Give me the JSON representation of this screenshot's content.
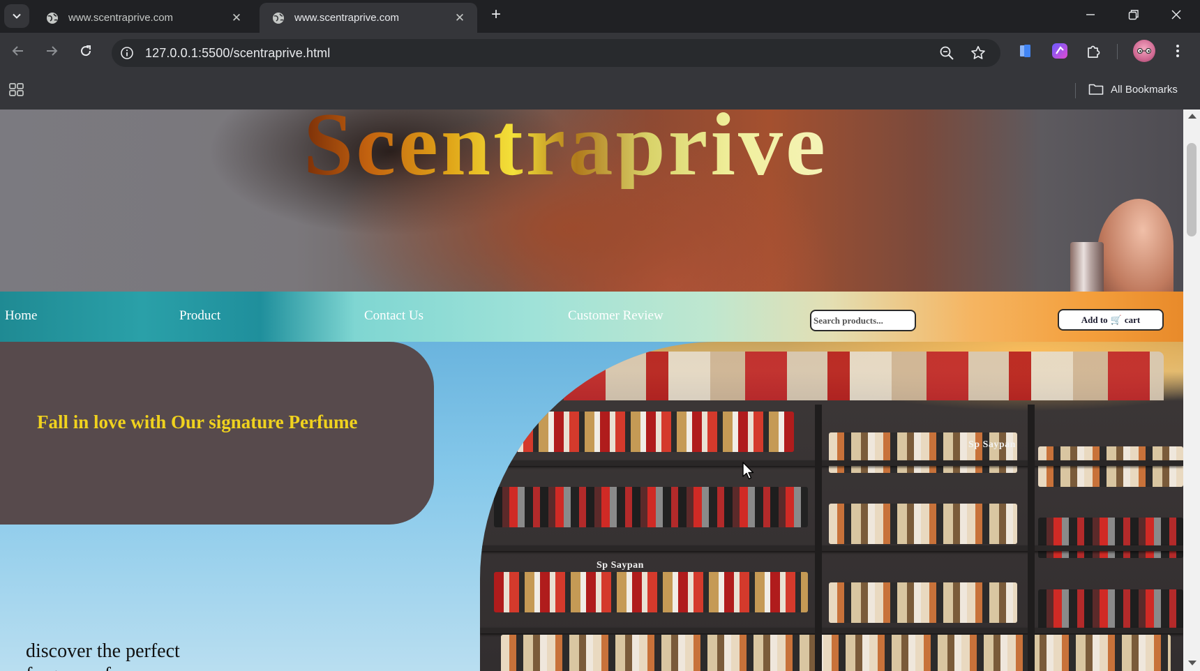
{
  "browser": {
    "tabs": [
      {
        "title": "www.scentraprive.com",
        "active": false
      },
      {
        "title": "www.scentraprive.com",
        "active": true
      }
    ],
    "url": "127.0.0.1:5500/scentraprive.html",
    "all_bookmarks_label": "All Bookmarks",
    "icons": [
      "tab-search-icon",
      "globe-icon",
      "close-icon",
      "plus-icon",
      "minimize-icon",
      "restore-icon",
      "window-close-icon",
      "back-icon",
      "forward-icon",
      "reload-icon",
      "site-info-icon",
      "zoom-icon",
      "star-icon",
      "extension-icon",
      "puzzle-icon",
      "profile-avatar",
      "kebab-menu-icon",
      "apps-grid-icon",
      "folder-icon"
    ]
  },
  "page": {
    "brand": "Scentraprive",
    "nav": {
      "home": "Home",
      "product": "Product",
      "contact": "Contact Us",
      "review": "Customer Review",
      "search_placeholder": "Search products...",
      "cart_prefix": "Add to",
      "cart_icon": "🛒",
      "cart_suffix": "cart"
    },
    "promo_title": "Fall in love with Our signature Perfume",
    "discover_line1": "discover the perfect",
    "discover_line2": "fragrance for",
    "shelf_labels": [
      "Sp Saypan",
      "Sp Saypan"
    ],
    "colors": {
      "promo_card": "#574a4c",
      "promo_text": "#f0d21e",
      "nav_text": "#ffffff"
    }
  }
}
